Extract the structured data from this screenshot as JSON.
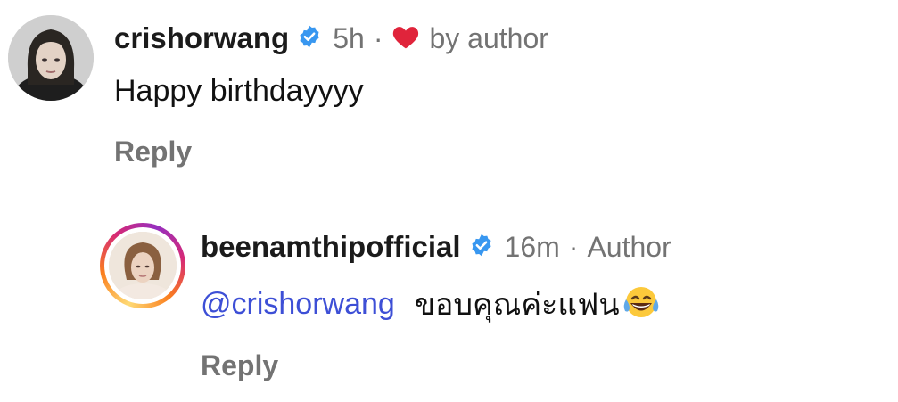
{
  "top_comment": {
    "username": "crishorwang",
    "time": "5h",
    "separator": "·",
    "liked_by_label": "by author",
    "text": "Happy birthdayyyy",
    "reply_label": "Reply",
    "verified_icon": "verified-badge-icon",
    "heart_icon": "heart-icon",
    "heart_color": "#e0243b"
  },
  "reply_comment": {
    "username": "beenamthipofficial",
    "time": "16m",
    "separator": "·",
    "author_label": "Author",
    "mention": "@crishorwang",
    "text": "ขอบคุณค่ะแฟน",
    "emoji": "😂",
    "reply_label": "Reply",
    "verified_icon": "verified-badge-icon"
  },
  "colors": {
    "verified_blue": "#3897f0",
    "mention_blue": "#3d4fd6",
    "meta_gray": "#737373"
  }
}
